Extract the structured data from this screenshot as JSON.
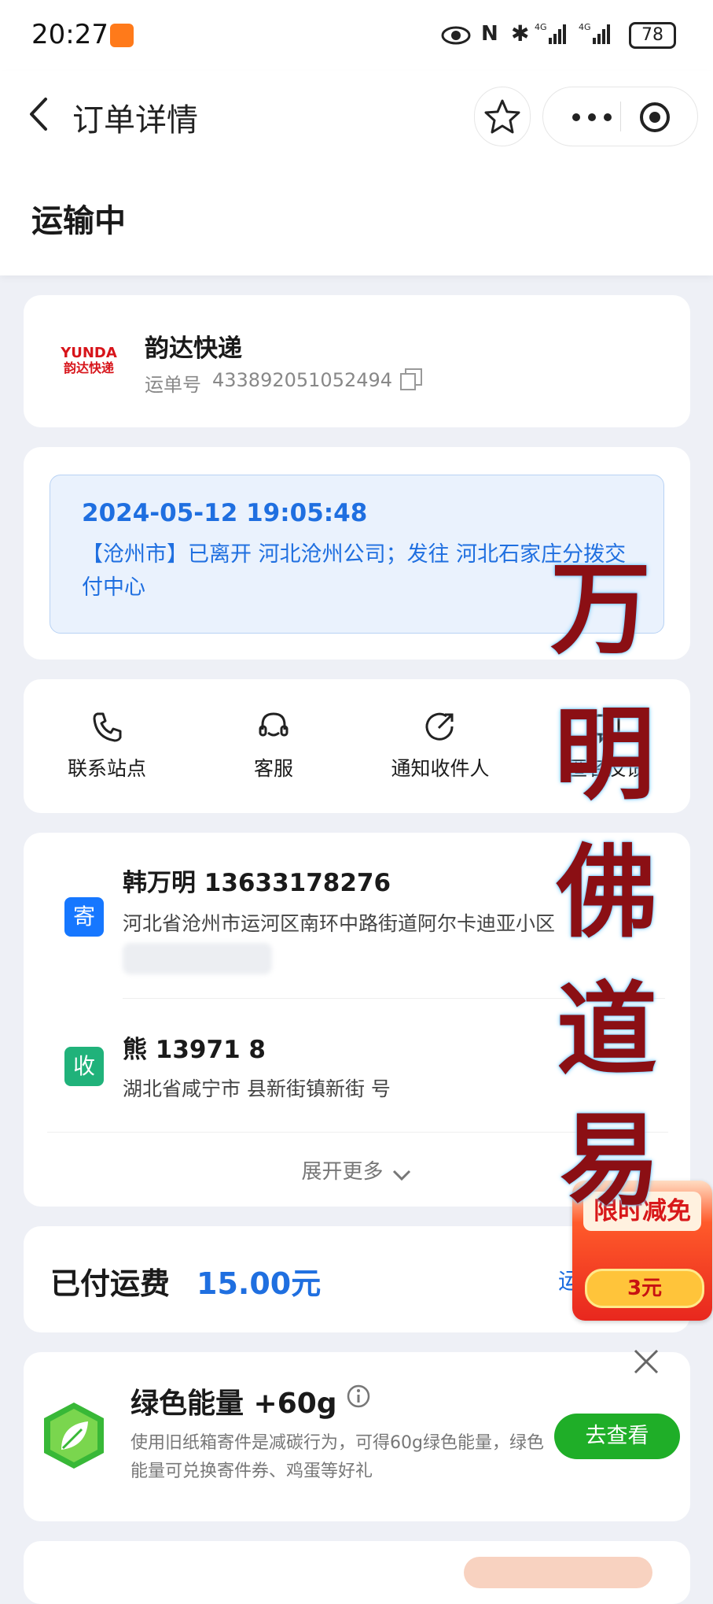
{
  "status_bar": {
    "time": "20:27",
    "battery": "78"
  },
  "nav": {
    "title": "订单详情"
  },
  "order": {
    "status": "运输中"
  },
  "courier": {
    "logo_text": "YUNDA",
    "logo_sub": "韵达快递",
    "name": "韵达快递",
    "waybill_label": "运单号",
    "waybill_number": "433892051052494"
  },
  "tracking": {
    "timestamp": "2024-05-12 19:05:48",
    "message": "【沧州市】已离开 河北沧州公司；发往 河北石家庄分拨交付中心"
  },
  "actions": [
    {
      "label": "联系站点",
      "icon": "phone-icon"
    },
    {
      "label": "客服",
      "icon": "headset-icon"
    },
    {
      "label": "通知收件人",
      "icon": "share-arrow-icon"
    },
    {
      "label": "匿名反馈",
      "icon": "feedback-icon"
    }
  ],
  "sender": {
    "tag": "寄",
    "name_phone": "韩万明 13633178276",
    "address": "河北省沧州市运河区南环中路街道阿尔卡迪亚小区"
  },
  "receiver": {
    "tag": "收",
    "name_phone": "熊 13971 8",
    "address": "湖北省咸宁市 县新街镇新街 号"
  },
  "expand": {
    "label": "展开更多"
  },
  "fee": {
    "label": "已付运费",
    "amount": "15.00元",
    "link": "运"
  },
  "promo_float": {
    "title": "限时减免",
    "amount": "3元"
  },
  "green": {
    "title": "绿色能量 +60g",
    "desc": "使用旧纸箱寄件是减碳行为，可得60g绿色能量，绿色能量可兑换寄件券、鸡蛋等好礼",
    "button": "去查看"
  },
  "watermark": {
    "chars": [
      "万",
      "明",
      "佛",
      "道",
      "易"
    ]
  },
  "colors": {
    "accent_blue": "#1f6fe0",
    "sender_tag": "#1677ff",
    "receiver_tag": "#20b27a",
    "green_button": "#1fae28",
    "watermark": "#8b0f14"
  }
}
